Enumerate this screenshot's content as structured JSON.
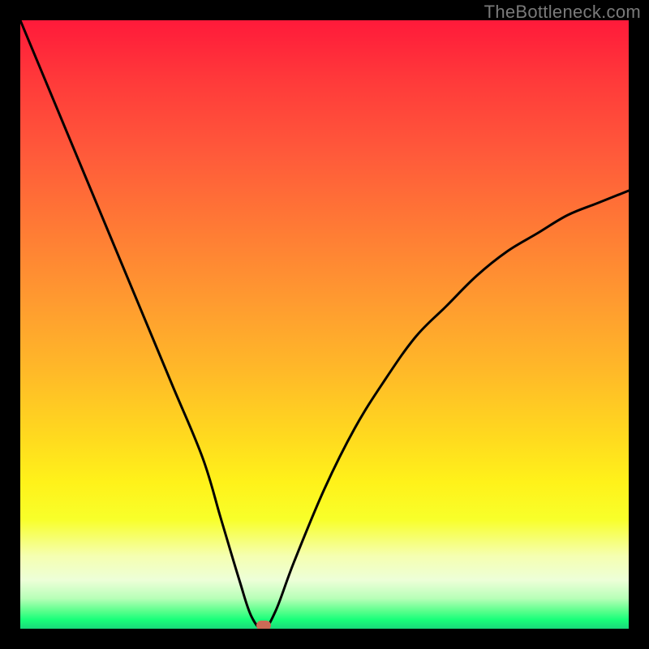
{
  "watermark": "TheBottleneck.com",
  "chart_data": {
    "type": "line",
    "title": "",
    "xlabel": "",
    "ylabel": "",
    "xlim": [
      0,
      100
    ],
    "ylim": [
      0,
      100
    ],
    "grid": false,
    "legend": false,
    "annotations": [],
    "background_gradient_stops": [
      {
        "pos": 0.0,
        "color": "#ff1a3a"
      },
      {
        "pos": 0.1,
        "color": "#ff3a3a"
      },
      {
        "pos": 0.22,
        "color": "#ff5a3a"
      },
      {
        "pos": 0.34,
        "color": "#ff7a35"
      },
      {
        "pos": 0.46,
        "color": "#ff9a30"
      },
      {
        "pos": 0.58,
        "color": "#ffba28"
      },
      {
        "pos": 0.68,
        "color": "#ffd81f"
      },
      {
        "pos": 0.76,
        "color": "#fff21a"
      },
      {
        "pos": 0.82,
        "color": "#f8ff2a"
      },
      {
        "pos": 0.88,
        "color": "#f5ffb0"
      },
      {
        "pos": 0.92,
        "color": "#edffd8"
      },
      {
        "pos": 0.95,
        "color": "#b8ffb8"
      },
      {
        "pos": 0.97,
        "color": "#5eff8e"
      },
      {
        "pos": 0.985,
        "color": "#19ff7a"
      },
      {
        "pos": 1.0,
        "color": "#19d87a"
      }
    ],
    "series": [
      {
        "name": "bottleneck-curve",
        "color": "#000000",
        "x": [
          0,
          5,
          10,
          15,
          20,
          25,
          30,
          33,
          36,
          38,
          40,
          42,
          45,
          50,
          55,
          60,
          65,
          70,
          75,
          80,
          85,
          90,
          95,
          100
        ],
        "y": [
          100,
          88,
          76,
          64,
          52,
          40,
          28,
          18,
          8,
          2,
          0,
          3,
          11,
          23,
          33,
          41,
          48,
          53,
          58,
          62,
          65,
          68,
          70,
          72
        ]
      }
    ],
    "minimum_marker": {
      "x": 40,
      "y": 0,
      "color": "#cc6a56"
    }
  }
}
